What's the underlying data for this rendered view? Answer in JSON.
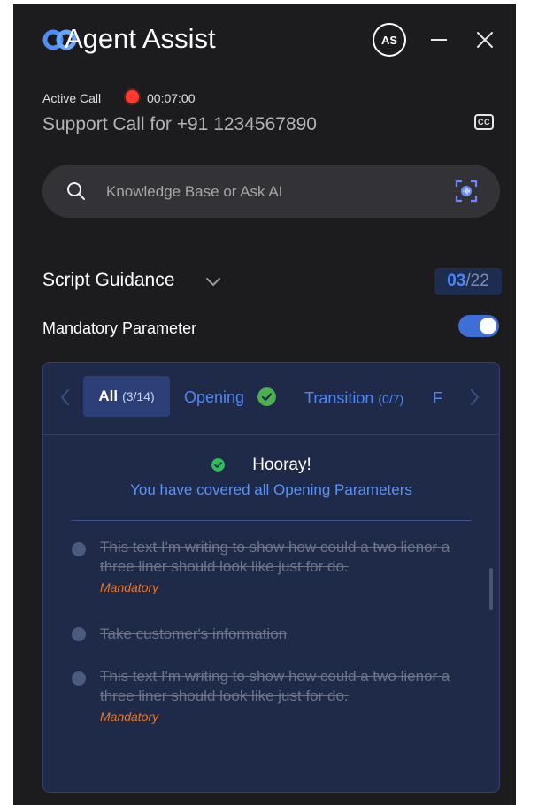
{
  "header": {
    "app_title": "Agent Assist",
    "avatar_initials": "AS"
  },
  "call": {
    "status_label": "Active Call",
    "timer": "00:07:00",
    "title": "Support Call for +91 1234567890",
    "cc_label": "CC"
  },
  "search": {
    "placeholder": "Knowledge Base or Ask AI"
  },
  "script": {
    "title": "Script Guidance",
    "current": "03",
    "total": "/22",
    "mandatory_label": "Mandatory Parameter",
    "mandatory_enabled": true
  },
  "tabs": {
    "all_label": "All",
    "all_count": "(3/14)",
    "opening_label": "Opening",
    "transition_label": "Transition",
    "transition_count": "(0/7)",
    "next_partial": "F"
  },
  "content": {
    "hooray": "Hooray!",
    "message": "You have covered all Opening Parameters",
    "items": [
      {
        "text": "This text I'm writing to show how could a two lienor a three liner should look like just for do.",
        "tag": "Mandatory"
      },
      {
        "text": "Take customer's information",
        "tag": ""
      },
      {
        "text": "This text I'm writing to show how could a two lienor a three liner should look like just for do.",
        "tag": "Mandatory"
      }
    ]
  },
  "colors": {
    "panel_bg": "#1c1b1e",
    "accent_blue": "#4f86f7",
    "record_red": "#ff3b30",
    "success_green": "#4caf50",
    "mandatory_orange": "#e8782a"
  }
}
